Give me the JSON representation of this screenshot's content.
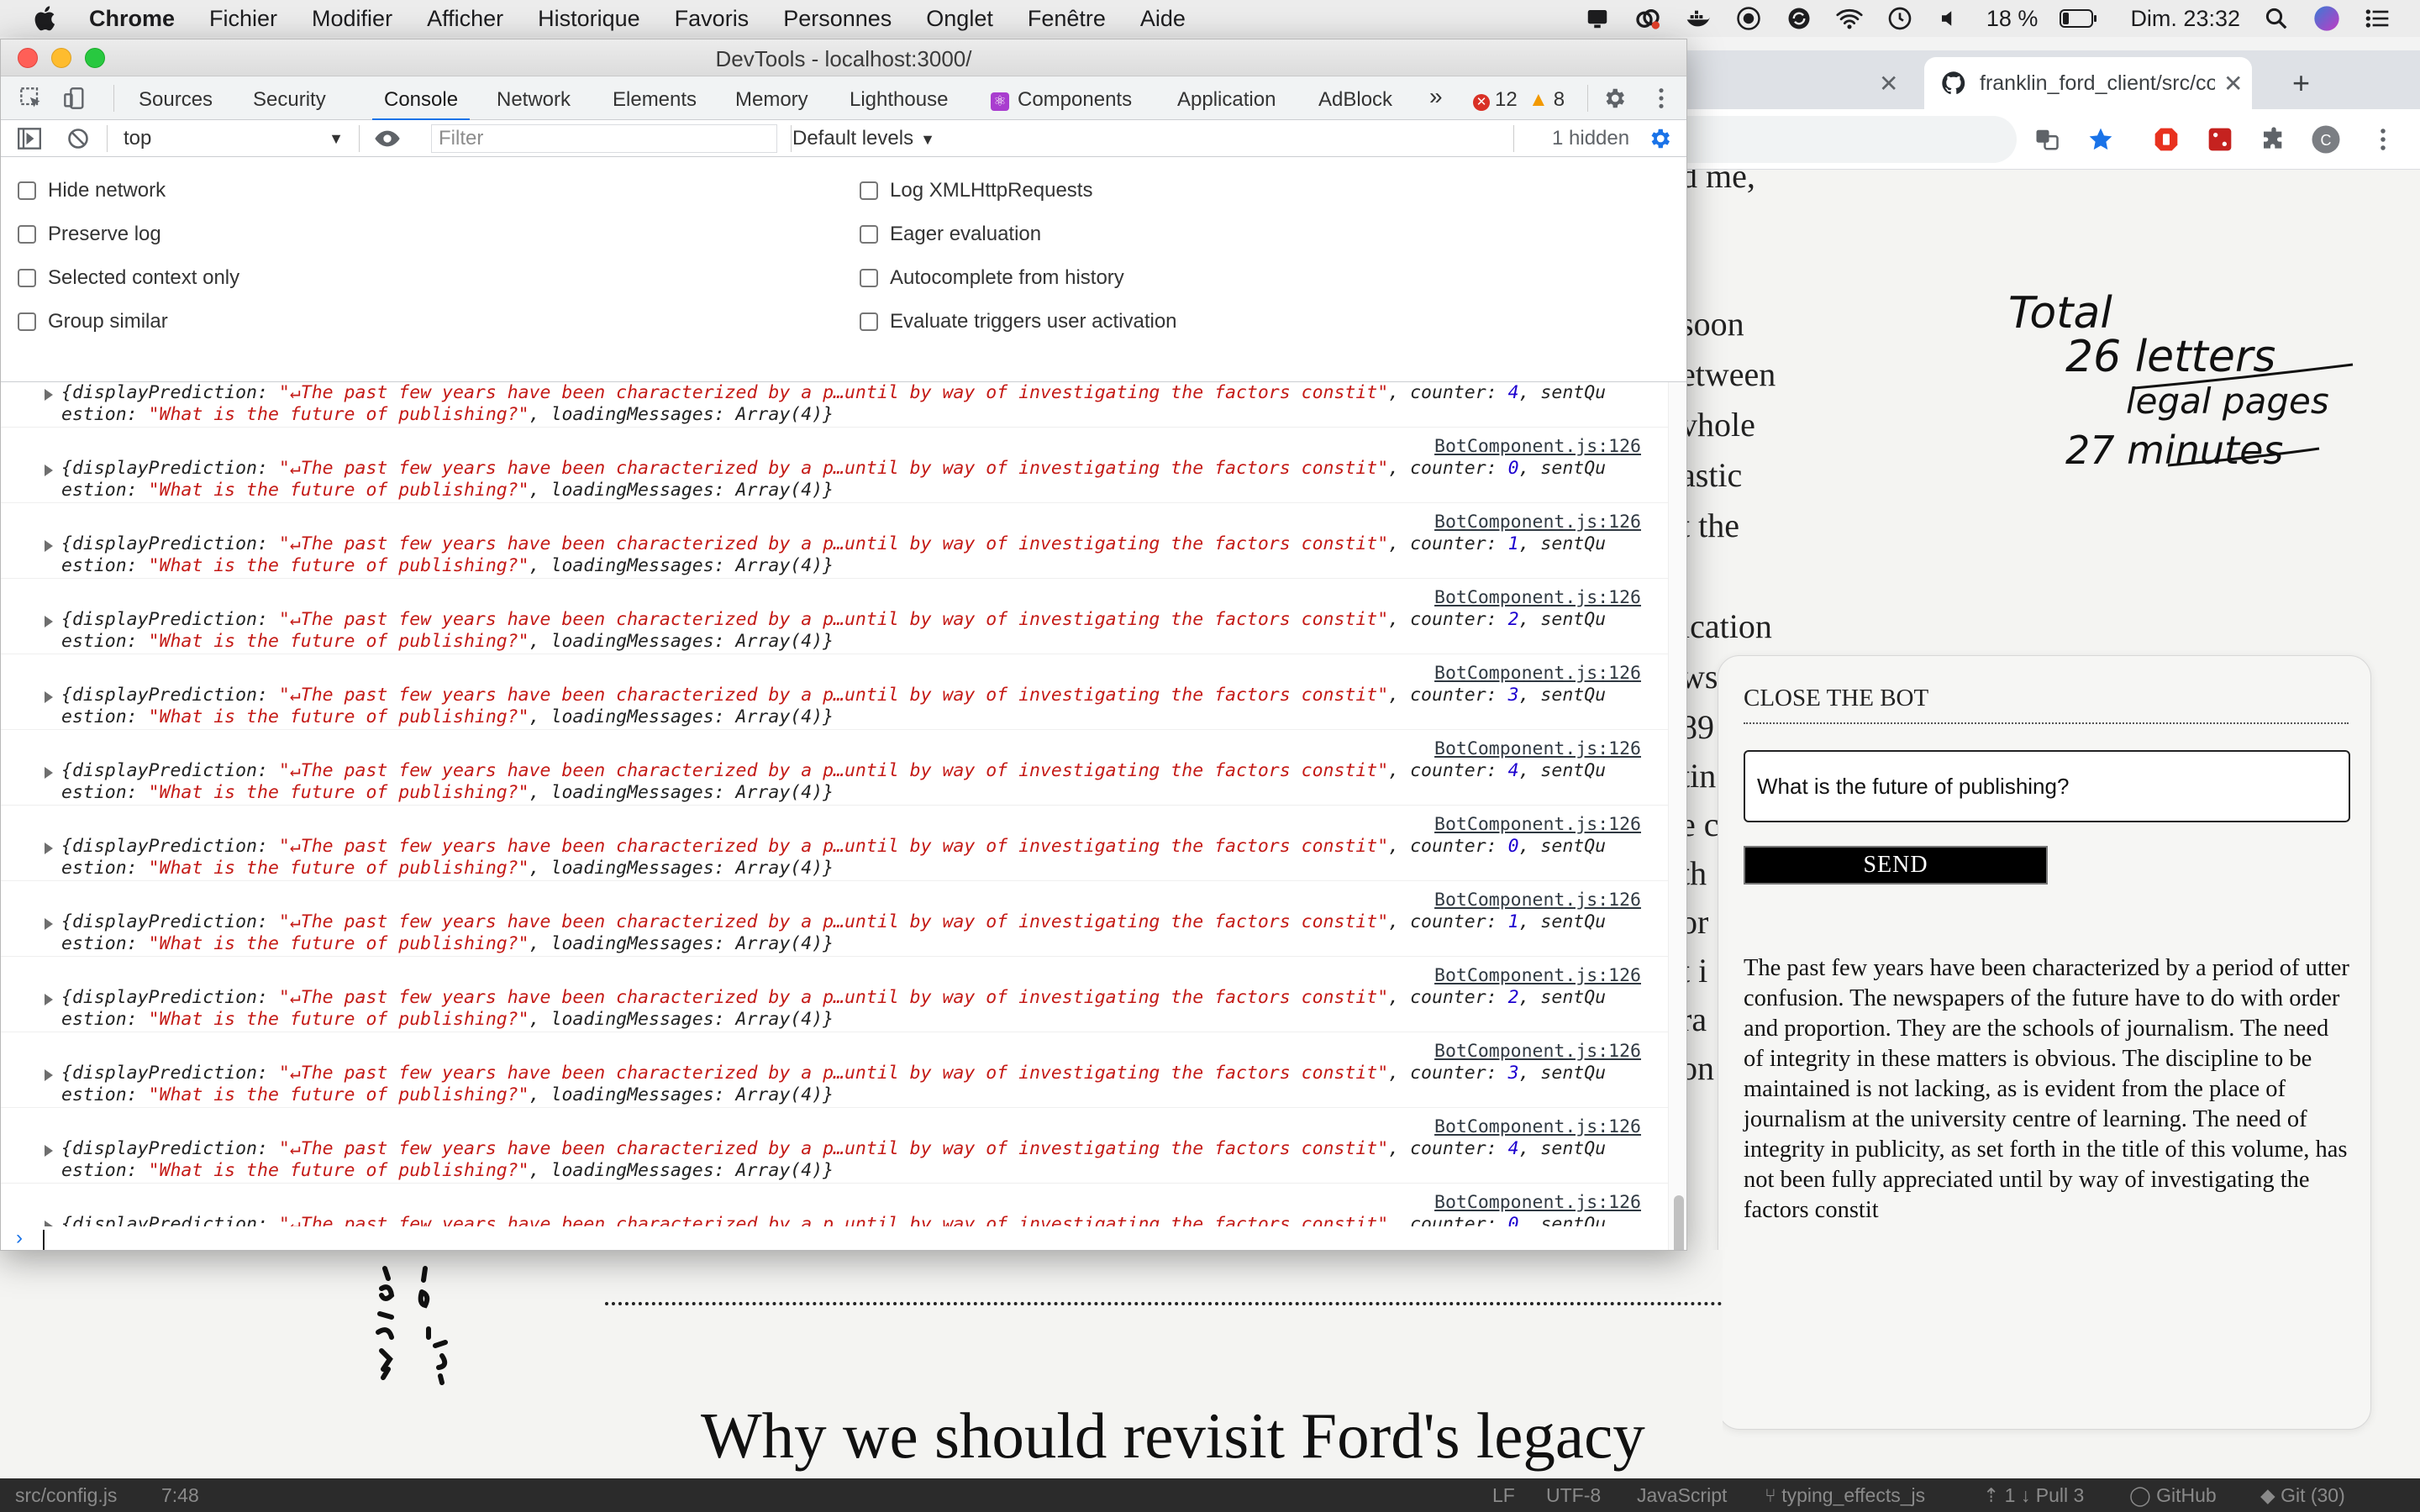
{
  "menubar": {
    "app": "Chrome",
    "items": [
      "Fichier",
      "Modifier",
      "Afficher",
      "Historique",
      "Favoris",
      "Personnes",
      "Onglet",
      "Fenêtre",
      "Aide"
    ],
    "battery": "18 %",
    "clock": "Dim. 23:32"
  },
  "chrome": {
    "tab_github": "franklin_ford_client/src/co"
  },
  "page": {
    "background_words": [
      "d me,",
      "soon",
      "etween",
      "vhole",
      "astic",
      "t the",
      "ication",
      "ws",
      "89",
      "tin",
      "e c",
      "th",
      "or",
      "t i",
      "ra",
      "on"
    ],
    "heading": "Why we should revisit Ford's legacy",
    "handwritten_note": [
      "Total",
      "26 letters",
      "legal pages",
      "27 minutes"
    ]
  },
  "bot": {
    "close_label": "CLOSE THE BOT",
    "input_value": "What is the future of publishing?",
    "send_label": "SEND",
    "answer": "The past few years have been characterized by a period of utter confusion. The newspapers of the future have to do with order and proportion. They are the schools of journalism. The need of integrity in these matters is obvious. The discipline to be maintained is not lacking, as is evident from the place of journalism at the university centre of learning. The need of integrity in publicity, as set forth in the title of this volume, has not been fully appreciated until by way of investigating the factors constit"
  },
  "devtools": {
    "title": "DevTools - localhost:3000/",
    "tabs": [
      "Sources",
      "Security",
      "Console",
      "Network",
      "Elements",
      "Memory",
      "Lighthouse",
      "Components",
      "Application",
      "AdBlock"
    ],
    "active_tab": "Console",
    "error_count": "12",
    "warning_count": "8",
    "context": "top",
    "filter_placeholder": "Filter",
    "levels": "Default levels",
    "hidden": "1 hidden",
    "settings_left": [
      "Hide network",
      "Preserve log",
      "Selected context only",
      "Group similar"
    ],
    "settings_right": [
      "Log XMLHttpRequests",
      "Eager evaluation",
      "Autocomplete from history",
      "Evaluate triggers user activation"
    ],
    "log_source": "BotComponent.js:126",
    "log_prefix": "{displayPrediction: ",
    "log_string": "\"↵The past few years have been characterized by a p…until by way of investigating the factors constit\"",
    "log_counter_label": ", counter: ",
    "log_after_counter": ", sentQu",
    "log_line2_a": "estion: ",
    "log_question": "\"What is the future of publishing?\"",
    "log_line2_b": ", loadingMessages: Array(4)}",
    "log_counters": [
      "4",
      "0",
      "1",
      "2",
      "3",
      "4",
      "0",
      "1",
      "2",
      "3",
      "4",
      "0"
    ]
  },
  "statusbar": {
    "file": "src/config.js",
    "position": "7:48",
    "eol": "LF",
    "encoding": "UTF-8",
    "language": "JavaScript",
    "branch": "typing_effects_js",
    "sync": "1 ↓ Pull 3",
    "github": "GitHub",
    "git": "Git (30)"
  },
  "colors": {
    "devtools_active_tab": "#1a73e8",
    "console_string": "#c41a16",
    "console_number": "#1c00cf",
    "error_badge": "#d93025",
    "warning_badge": "#f29900"
  }
}
